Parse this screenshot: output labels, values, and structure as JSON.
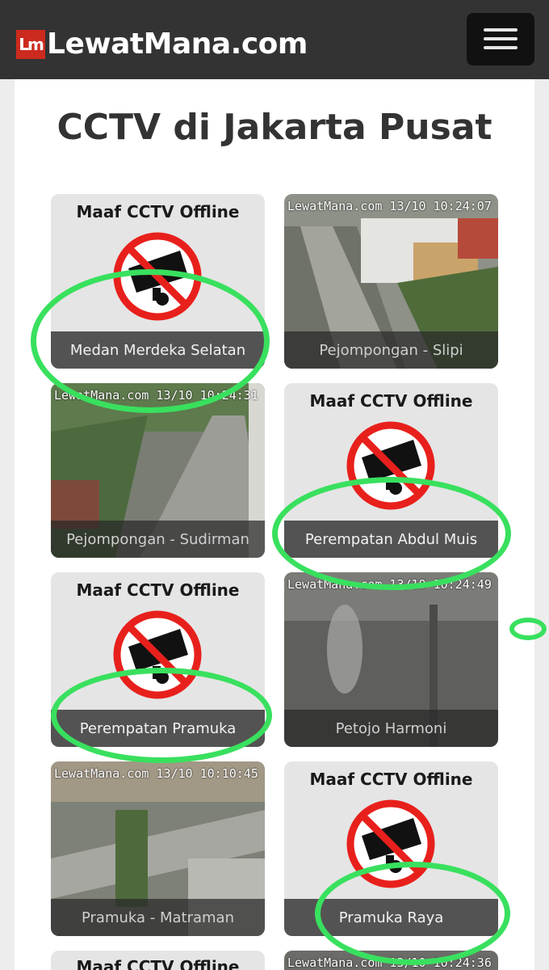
{
  "header": {
    "logo_mark": "Lm",
    "logo_text": "LewatMana.com",
    "menu_icon": "hamburger-icon"
  },
  "page": {
    "title": "CCTV di Jakarta Pusat"
  },
  "offline_message": "Maaf CCTV Offline",
  "cameras": [
    {
      "name": "Medan Merdeka Selatan",
      "status": "offline",
      "stamp": ""
    },
    {
      "name": "Pejompongan - Slipi",
      "status": "live",
      "stamp": "LewatMana.com 13/10 10:24:07"
    },
    {
      "name": "Pejompongan - Sudirman",
      "status": "live",
      "stamp": "LewatMana.com 13/10 10:24:31"
    },
    {
      "name": "Perempatan Abdul Muis",
      "status": "offline",
      "stamp": ""
    },
    {
      "name": "Perempatan Pramuka",
      "status": "offline",
      "stamp": ""
    },
    {
      "name": "Petojo Harmoni",
      "status": "live",
      "stamp": "LewatMana.com 13/10 10:24:49"
    },
    {
      "name": "Pramuka - Matraman",
      "status": "live",
      "stamp": "LewatMana.com 13/10 10:10:45"
    },
    {
      "name": "Pramuka Raya",
      "status": "offline",
      "stamp": ""
    },
    {
      "name": "",
      "status": "offline",
      "stamp": ""
    },
    {
      "name": "",
      "status": "live",
      "stamp": "LewatMana.com 13/10 10:24:36"
    }
  ],
  "colors": {
    "header_bg": "#333333",
    "logo_red": "#cc2a1e",
    "highlight_ring": "#39e05e",
    "no_sign_red": "#e8201c"
  }
}
